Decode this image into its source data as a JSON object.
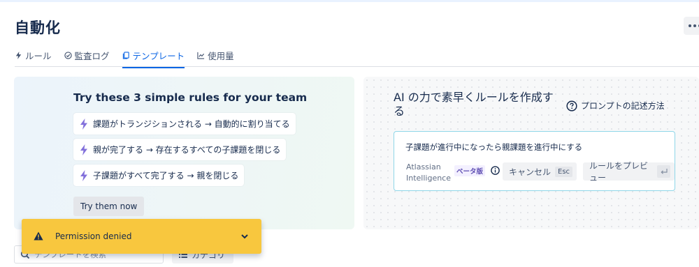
{
  "header": {
    "title": "自動化"
  },
  "tabs": [
    {
      "label": "ルール",
      "icon": "bolt-icon"
    },
    {
      "label": "監査ログ",
      "icon": "check-circle-icon"
    },
    {
      "label": "テンプレート",
      "icon": "copy-icon",
      "active": true
    },
    {
      "label": "使用量",
      "icon": "chart-icon"
    }
  ],
  "templates_card": {
    "title": "Try these 3 simple rules for your team",
    "rules": [
      "課題がトランジションされる → 自動的に割り当てる",
      "親が完了する → 存在するすべての子課題を閉じる",
      "子課題がすべて完了する → 親を閉じる"
    ],
    "button": "Try them now"
  },
  "ai_card": {
    "title": "AI の力で素早くルールを作成する",
    "help_link": "プロンプトの記述方法",
    "prompt_value": "子課題が進行中になったら親課題を進行中にする",
    "brand": "Atlassian Intelligence",
    "beta": "ベータ版",
    "cancel_label": "キャンセル",
    "cancel_key": "Esc",
    "preview_label": "ルールをプレビュー"
  },
  "filters": {
    "search_placeholder": "テンプレートを検索",
    "category_label": "カテゴリ"
  },
  "flag": {
    "message": "Permission denied"
  },
  "colors": {
    "accent": "#0c66e4",
    "bolt": "#6e5dc6",
    "warning": "#f8c73e"
  }
}
